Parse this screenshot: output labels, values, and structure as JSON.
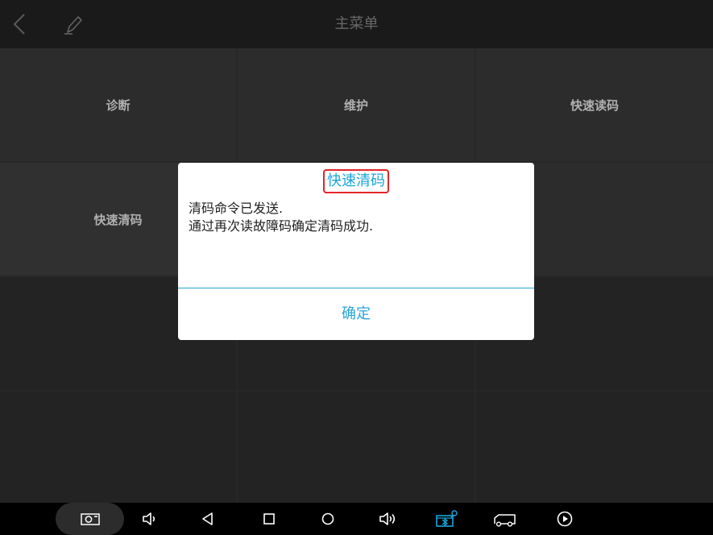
{
  "header": {
    "title": "主菜单"
  },
  "grid": {
    "cells": [
      {
        "label": "诊断"
      },
      {
        "label": "维护"
      },
      {
        "label": "快速读码"
      },
      {
        "label": "快速清码"
      }
    ]
  },
  "dialog": {
    "title": "快速清码",
    "line1": "清码命令已发送.",
    "line2": "通过再次读故障码确定清码成功.",
    "ok_label": "确定"
  },
  "colors": {
    "accent": "#29a4d8",
    "highlight_border": "#e2262b"
  }
}
